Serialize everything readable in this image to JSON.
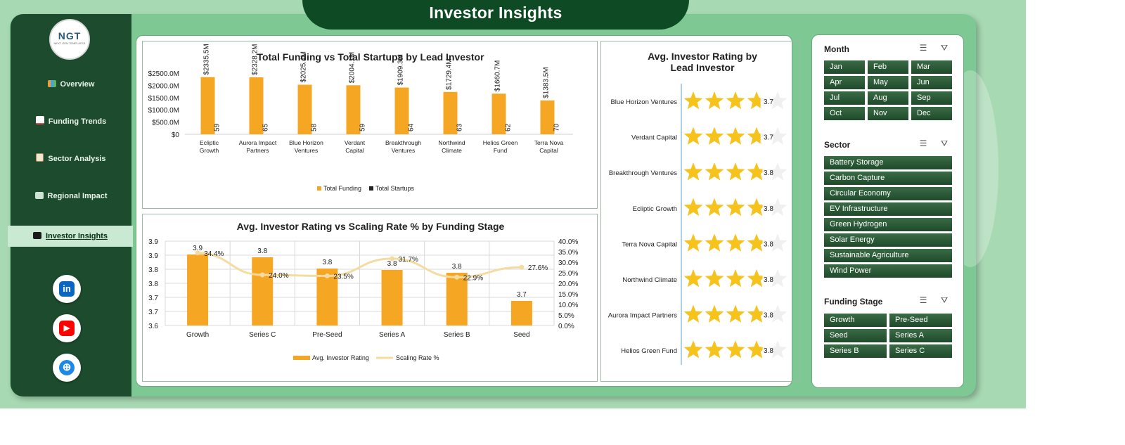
{
  "header": {
    "title": "Investor Insights"
  },
  "logo": {
    "text": "NGT",
    "subtext": "NEXT GEN TEMPLATES"
  },
  "sidebar": {
    "items": [
      {
        "label": "Overview",
        "icon": "bar-chart-icon"
      },
      {
        "label": "Funding Trends",
        "icon": "trend-chart-icon"
      },
      {
        "label": "Sector Analysis",
        "icon": "clipboard-icon"
      },
      {
        "label": "Regional Impact",
        "icon": "map-icon"
      },
      {
        "label": "Investor Insights",
        "icon": "wallet-icon",
        "active": true
      }
    ],
    "social": [
      {
        "name": "linkedin",
        "glyph": "in",
        "color": "#0a66c2"
      },
      {
        "name": "youtube",
        "glyph": "▶",
        "color": "#ff0000"
      },
      {
        "name": "website",
        "glyph": "⊕",
        "color": "#1e88e5"
      }
    ]
  },
  "slicers": {
    "month": {
      "title": "Month",
      "items": [
        "Jan",
        "Feb",
        "Mar",
        "Apr",
        "May",
        "Jun",
        "Jul",
        "Aug",
        "Sep",
        "Oct",
        "Nov",
        "Dec"
      ]
    },
    "sector": {
      "title": "Sector",
      "items": [
        "Battery Storage",
        "Carbon Capture",
        "Circular Economy",
        "EV Infrastructure",
        "Green Hydrogen",
        "Solar Energy",
        "Sustainable Agriculture",
        "Wind Power"
      ]
    },
    "stage": {
      "title": "Funding Stage",
      "items": [
        "Growth",
        "Pre-Seed",
        "Seed",
        "Series A",
        "Series B",
        "Series C"
      ]
    }
  },
  "chart_data": [
    {
      "type": "bar",
      "title": "Total Funding vs Total Startups by Lead Investor",
      "categories": [
        "Ecliptic Growth",
        "Aurora Impact Partners",
        "Blue Horizon Ventures",
        "Verdant Capital",
        "Breakthrough Ventures",
        "Northwind Climate",
        "Helios Green Fund",
        "Terra Nova Capital"
      ],
      "series": [
        {
          "name": "Total Funding",
          "values": [
            2335.5,
            2328.2,
            2025.4,
            2004.1,
            1909.3,
            1729.4,
            1660.7,
            1383.5
          ],
          "labels": [
            "$2335.5M",
            "$2328.2M",
            "$2025.4M",
            "$2004.1M",
            "$1909.3M",
            "$1729.4M",
            "$1660.7M",
            "$1383.5M"
          ],
          "color": "#f5a623"
        },
        {
          "name": "Total Startups",
          "values": [
            59,
            65,
            58,
            59,
            64,
            63,
            62,
            70
          ],
          "color": "#222222"
        }
      ],
      "yticks": [
        "$0",
        "$500.0M",
        "$1000.0M",
        "$1500.0M",
        "$2000.0M",
        "$2500.0M"
      ],
      "ylim": [
        0,
        2500
      ],
      "legend": "bottom"
    },
    {
      "type": "bar",
      "title": "Avg. Investor Rating vs Scaling Rate % by Funding Stage",
      "categories": [
        "Growth",
        "Series C",
        "Pre-Seed",
        "Series A",
        "Series B",
        "Seed"
      ],
      "series": [
        {
          "name": "Avg. Investor Rating",
          "values": [
            3.9,
            3.8,
            3.8,
            3.8,
            3.8,
            3.7
          ],
          "color": "#f5a623"
        },
        {
          "name": "Scaling Rate %",
          "values": [
            34.4,
            24.0,
            23.5,
            31.7,
            22.9,
            27.6
          ],
          "labels": [
            "34.4%",
            "24.0%",
            "23.5%",
            "31.7%",
            "22.9%",
            "27.6%"
          ],
          "type": "line",
          "color": "#f5dba0"
        }
      ],
      "yticks_left": [
        "3.6",
        "3.7",
        "3.7",
        "3.8",
        "3.8",
        "3.9",
        "3.9"
      ],
      "yticks_right": [
        "0.0%",
        "5.0%",
        "10.0%",
        "15.0%",
        "20.0%",
        "25.0%",
        "30.0%",
        "35.0%",
        "40.0%"
      ],
      "ylim": [
        3.6,
        3.92
      ],
      "ylim_right": [
        0,
        40
      ],
      "legend": "bottom"
    },
    {
      "type": "bar",
      "title": "Avg. Investor Rating by Lead Investor",
      "categories": [
        "Blue Horizon Ventures",
        "Verdant Capital",
        "Breakthrough Ventures",
        "Ecliptic Growth",
        "Terra Nova Capital",
        "Northwind Climate",
        "Aurora Impact Partners",
        "Helios Green Fund"
      ],
      "values": [
        3.7,
        3.7,
        3.8,
        3.8,
        3.8,
        3.8,
        3.8,
        3.8
      ],
      "max": 5
    }
  ]
}
